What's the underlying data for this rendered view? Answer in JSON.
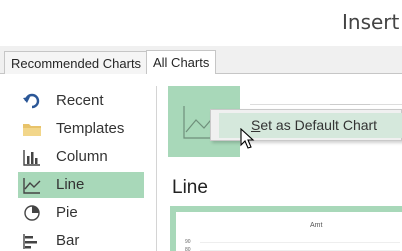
{
  "window": {
    "title": "Insert C"
  },
  "tabs": [
    {
      "label": "Recommended Charts",
      "active": false
    },
    {
      "label": "All Charts",
      "active": true
    }
  ],
  "sidebar": {
    "items": [
      {
        "label": "Recent",
        "icon": "undo-arrow-icon",
        "active": false
      },
      {
        "label": "Templates",
        "icon": "folder-icon",
        "active": false
      },
      {
        "label": "Column",
        "icon": "column-chart-icon",
        "active": false
      },
      {
        "label": "Line",
        "icon": "line-chart-icon",
        "active": true
      },
      {
        "label": "Pie",
        "icon": "pie-chart-icon",
        "active": false
      },
      {
        "label": "Bar",
        "icon": "bar-chart-icon",
        "active": false
      }
    ]
  },
  "context_menu": {
    "items": [
      {
        "label": "Set as Default Chart",
        "highlighted": true
      }
    ]
  },
  "main": {
    "section_title": "Line",
    "preview": {
      "title": "Amt",
      "ticks": [
        "90",
        "80"
      ]
    }
  },
  "colors": {
    "accent": "#a8d8b9",
    "accent_light": "#d5e8dc",
    "folder": "#e8c36a",
    "icon_blue": "#2b5797"
  }
}
